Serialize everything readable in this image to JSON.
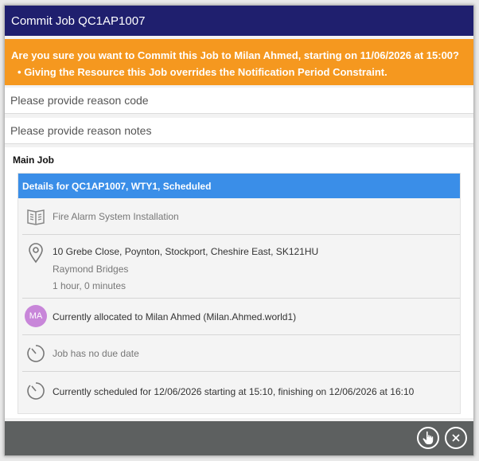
{
  "dialog": {
    "title": "Commit Job QC1AP1007"
  },
  "warning": {
    "question": "Are you sure you want to Commit this Job to Milan Ahmed, starting on 11/06/2026 at 15:00?",
    "bullet": "Giving the Resource this Job overrides the Notification Period Constraint."
  },
  "reason": {
    "code_placeholder": "Please provide reason code",
    "notes_placeholder": "Please provide reason notes"
  },
  "main_job": {
    "label": "Main Job",
    "details_header": "Details for QC1AP1007, WTY1, Scheduled",
    "job_type": "Fire Alarm System Installation",
    "address": "10 Grebe Close, Poynton, Stockport, Cheshire East, SK121HU",
    "contact": "Raymond Bridges",
    "duration": "1 hour, 0 minutes",
    "avatar_initials": "MA",
    "allocated": "Currently allocated to Milan Ahmed (Milan.Ahmed.world1)",
    "due_date": "Job has no due date",
    "scheduled": "Currently scheduled for 12/06/2026 starting at 15:10, finishing on 12/06/2026 at 16:10"
  },
  "footer": {
    "confirm_icon": "hand-pointer-icon",
    "close_icon": "close-icon"
  },
  "colors": {
    "title_bg": "#1f1f6e",
    "warning_bg": "#f5981f",
    "header_bg": "#3a8ee8",
    "avatar_bg": "#c886d9",
    "footer_bg": "#5d6060"
  }
}
